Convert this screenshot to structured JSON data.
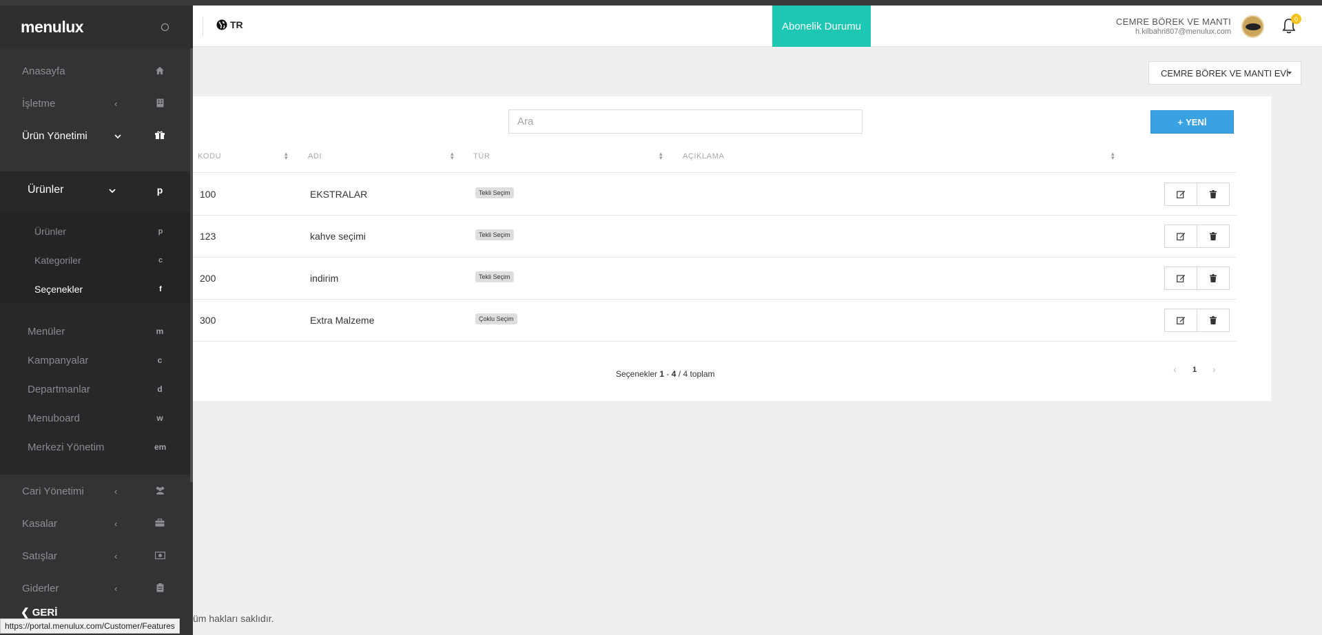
{
  "brand": {
    "logo": "menulux"
  },
  "sidebar": {
    "items": [
      {
        "label": "Anasayfa",
        "icon": "home-icon"
      },
      {
        "label": "İşletme",
        "icon": "building-icon",
        "arrow": "‹"
      },
      {
        "label": "Ürün Yönetimi",
        "icon": "gift-icon",
        "arrow": "⌄"
      },
      {
        "label": "Cari Yönetimi",
        "icon": "users-icon",
        "arrow": "‹"
      },
      {
        "label": "Kasalar",
        "icon": "briefcase-icon",
        "arrow": "‹"
      },
      {
        "label": "Satışlar",
        "icon": "money-icon",
        "arrow": "‹"
      },
      {
        "label": "Giderler",
        "icon": "clipboard-icon",
        "arrow": "‹"
      }
    ],
    "sub": [
      {
        "label": "Ürünler",
        "icon_letter": "p",
        "arrow": "⌄"
      },
      {
        "label": "Menüler",
        "icon_letter": "m"
      },
      {
        "label": "Kampanyalar",
        "icon_letter": "c"
      },
      {
        "label": "Departmanlar",
        "icon_letter": "d"
      },
      {
        "label": "Menuboard",
        "icon_letter": "w"
      },
      {
        "label": "Merkezi Yönetim",
        "icon_letter": "em"
      }
    ],
    "sub2": [
      {
        "label": "Ürünler",
        "icon_letter": "p"
      },
      {
        "label": "Kategoriler",
        "icon_letter": "c"
      },
      {
        "label": "Seçenekler",
        "icon_letter": "f"
      }
    ],
    "back_label": "GERİ"
  },
  "header": {
    "language": "TR",
    "subscription_label": "Abonelik Durumu",
    "user_name": "CEMRE BÖREK VE MANTI",
    "user_email": "h.kilbahri807@menulux.com",
    "notification_count": "0"
  },
  "store_select": {
    "value": "CEMRE BÖREK VE MANTI EVİ"
  },
  "search": {
    "placeholder": "Ara"
  },
  "new_button": {
    "label": "YENİ"
  },
  "table": {
    "columns": [
      "KODU",
      "ADI",
      "TÜR",
      "AÇIKLAMA"
    ],
    "rows": [
      {
        "code": "100",
        "name": "EKSTRALAR",
        "type": "Tekli Seçim",
        "description": ""
      },
      {
        "code": "123",
        "name": "kahve seçimi",
        "type": "Tekli Seçim",
        "description": ""
      },
      {
        "code": "200",
        "name": "indirim",
        "type": "Tekli Seçim",
        "description": ""
      },
      {
        "code": "300",
        "name": "Extra Malzeme",
        "type": "Çoklu Seçim",
        "description": ""
      }
    ]
  },
  "pagination": {
    "prefix": "Seçenekler",
    "from": "1",
    "dash": "-",
    "to": "4",
    "of": "/ 4 toplam",
    "current_page": "1"
  },
  "footer": {
    "text": "üm hakları saklıdır."
  },
  "status_url": "https://portal.menulux.com/Customer/Features",
  "colors": {
    "accent": "#1dc7b4",
    "primary_button": "#3aa2e0",
    "sidebar": "#333335",
    "badge": "#f3c21b"
  }
}
